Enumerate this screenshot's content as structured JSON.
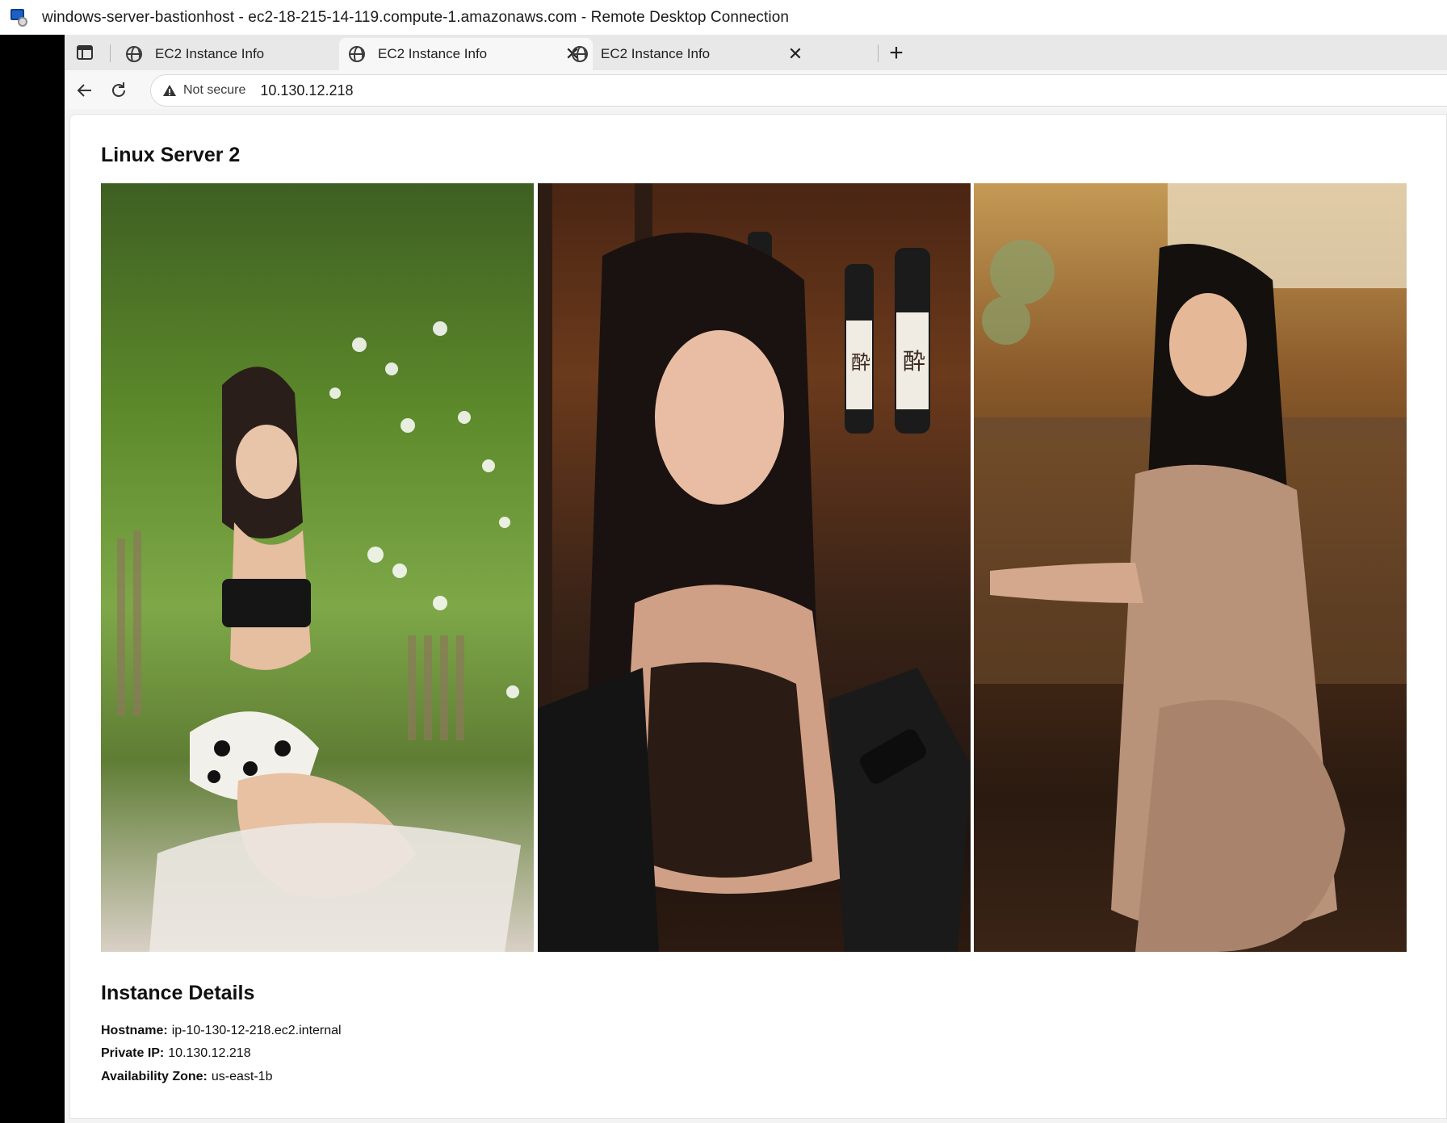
{
  "window": {
    "title": "windows-server-bastionhost - ec2-18-215-14-119.compute-1.amazonaws.com - Remote Desktop Connection",
    "icon": "remote-desktop-icon"
  },
  "browser": {
    "tabs": [
      {
        "label": "EC2 Instance Info",
        "active": false,
        "icon": "globe-icon"
      },
      {
        "label": "EC2 Instance Info",
        "active": true,
        "icon": "globe-icon"
      },
      {
        "label": "EC2 Instance Info",
        "active": false,
        "icon": "globe-icon"
      }
    ],
    "tab_close_glyph": "✕",
    "new_tab_glyph": "+",
    "security_label": "Not secure",
    "url": "10.130.12.218"
  },
  "page": {
    "title": "Linux Server 2",
    "photos": [
      {
        "name": "photo-garden"
      },
      {
        "name": "photo-bar-shelves"
      },
      {
        "name": "photo-cafe-counter"
      }
    ],
    "details": {
      "heading": "Instance Details",
      "rows": [
        {
          "label": "Hostname:",
          "value": "ip-10-130-12-218.ec2.internal"
        },
        {
          "label": "Private IP:",
          "value": "10.130.12.218"
        },
        {
          "label": "Availability Zone:",
          "value": "us-east-1b"
        }
      ]
    }
  }
}
